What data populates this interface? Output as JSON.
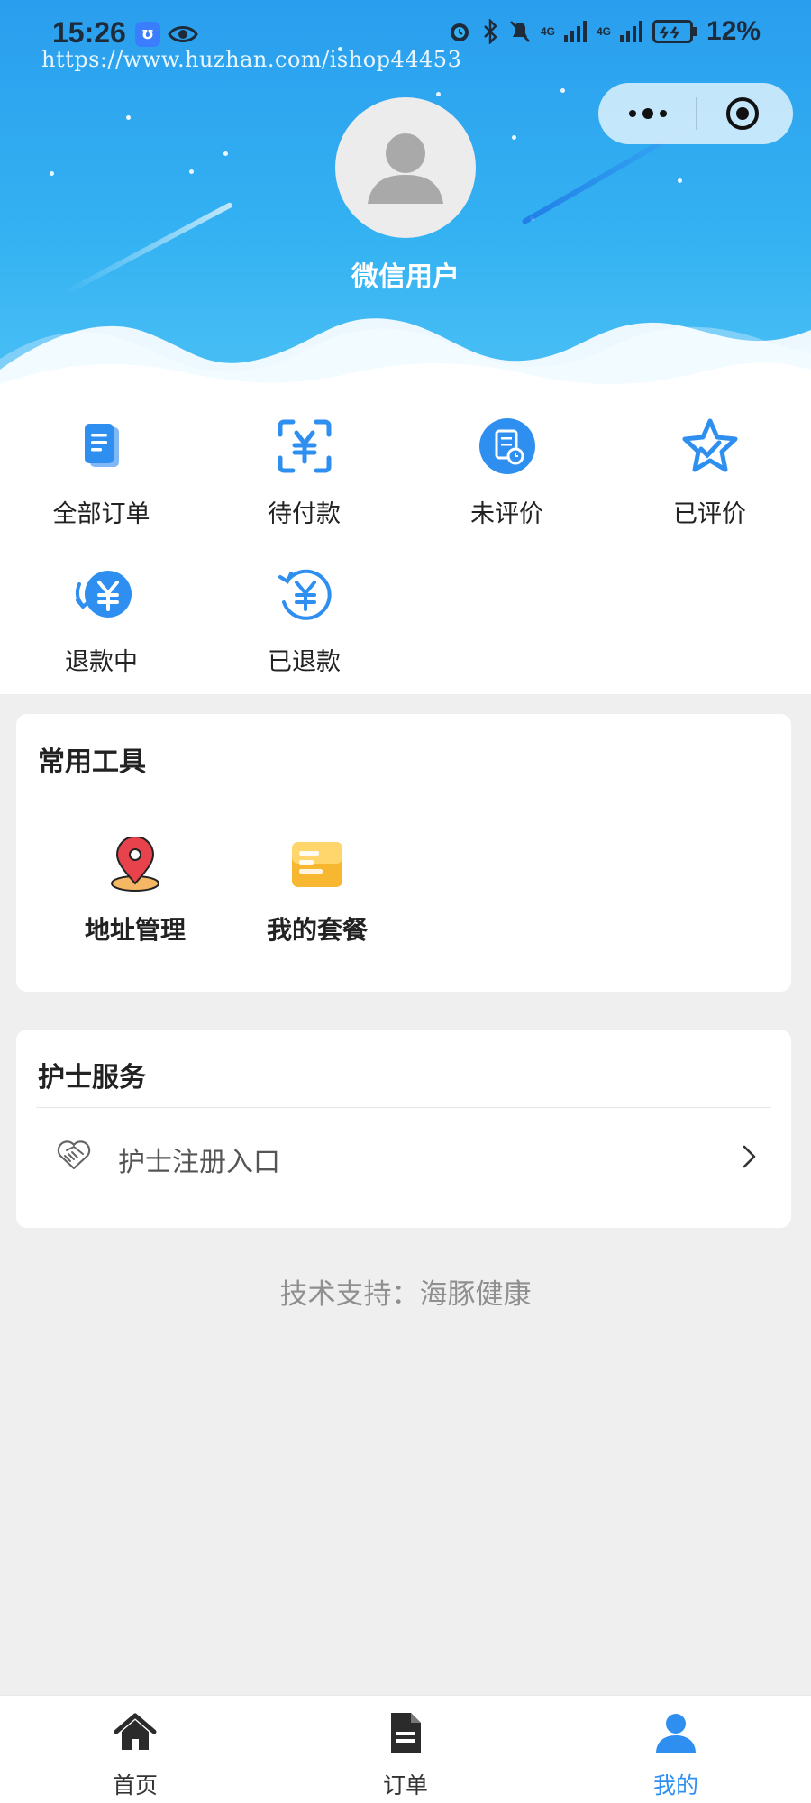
{
  "status_bar": {
    "time": "15:26",
    "app_badge": "ʊ",
    "network_1": "4G",
    "network_2": "4G",
    "battery": "12%"
  },
  "watermark": "https://www.huzhan.com/ishop44453",
  "profile": {
    "username": "微信用户"
  },
  "orders": [
    {
      "label": "全部订单",
      "icon": "all-orders-icon"
    },
    {
      "label": "待付款",
      "icon": "pending-payment-icon"
    },
    {
      "label": "未评价",
      "icon": "unreviewed-icon"
    },
    {
      "label": "已评价",
      "icon": "reviewed-star-icon"
    },
    {
      "label": "退款中",
      "icon": "refunding-icon"
    },
    {
      "label": "已退款",
      "icon": "refunded-icon"
    }
  ],
  "tools": {
    "title": "常用工具",
    "items": [
      {
        "label": "地址管理",
        "icon": "location-pin-icon"
      },
      {
        "label": "我的套餐",
        "icon": "package-card-icon"
      }
    ]
  },
  "nurse": {
    "title": "护士服务",
    "item_label": "护士注册入口",
    "icon": "handshake-icon"
  },
  "support_text": "技术支持：海豚健康",
  "tabbar": [
    {
      "label": "首页",
      "icon": "home-icon",
      "active": false
    },
    {
      "label": "订单",
      "icon": "document-icon",
      "active": false
    },
    {
      "label": "我的",
      "icon": "user-icon",
      "active": true
    }
  ],
  "colors": {
    "accent": "#2e8ff0",
    "header_start": "#2a9eee",
    "header_end": "#4cc0f5",
    "page_bg": "#efefef"
  }
}
